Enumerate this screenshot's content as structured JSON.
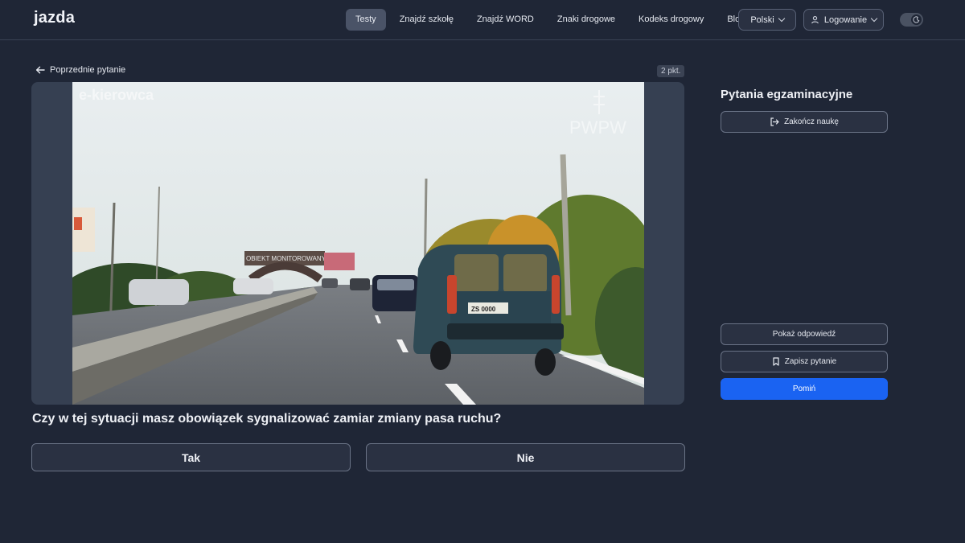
{
  "header": {
    "logo_text": "jazda",
    "nav": [
      {
        "label": "Testy",
        "active": true
      },
      {
        "label": "Znajdź szkołę"
      },
      {
        "label": "Znajdź WORD"
      },
      {
        "label": "Znaki drogowe"
      },
      {
        "label": "Kodeks drogowy"
      },
      {
        "label": "Blog"
      }
    ],
    "language_label": "Polski",
    "login_label": "Logowanie",
    "theme_toggle_icon": "moon-icon"
  },
  "main": {
    "back_label": "Poprzednie pytanie",
    "points_badge": "2 pkt.",
    "media": {
      "watermark_left": "e-kierowca",
      "watermark_right": "PWPW",
      "sign_text": "OBIEKT MONITOROWANY",
      "plate_text": "ZS 0000"
    },
    "question": "Czy w tej sytuacji masz obowiązek sygnalizować zamiar zmiany pasa ruchu?",
    "answers": [
      "Tak",
      "Nie"
    ]
  },
  "sidebar": {
    "title": "Pytania egzaminacyjne",
    "finish_label": "Zakończ naukę",
    "show_answer_label": "Pokaż odpowiedź",
    "save_label": "Zapisz pytanie",
    "skip_label": "Pomiń"
  },
  "colors": {
    "background": "#1f2636",
    "accent": "#1a63f2",
    "logo_accent": "#5b8cff"
  }
}
